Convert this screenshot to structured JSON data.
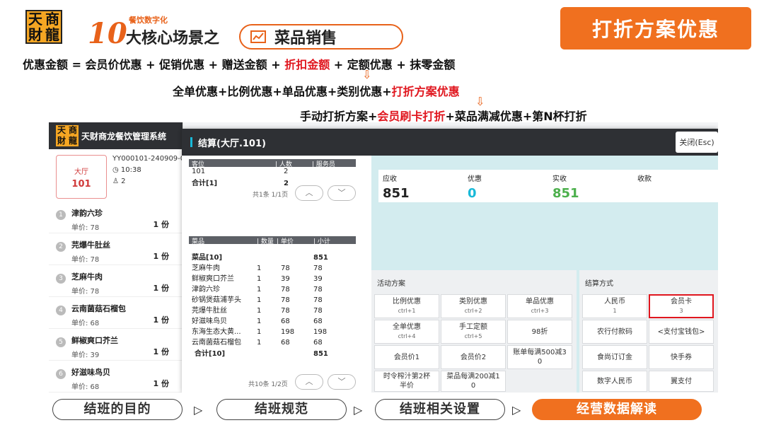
{
  "logo": {
    "chars": [
      "天",
      "商",
      "財",
      "龍"
    ]
  },
  "brand": {
    "ten": "10",
    "sub": "餐饮数字化",
    "main": "大核心场景之",
    "pill": "菜品销售"
  },
  "hero": "打折方案优惠",
  "formulas": {
    "line1_a": "优惠金额 = 会员价优惠 + 促销优惠 + 赠送金额 + ",
    "line1_hl": "折扣金额",
    "line1_b": " + 定额优惠 + 抹零金额",
    "line2_a": "全单优惠+比例优惠+单品优惠+类别优惠+",
    "line2_hl": "打折方案优惠",
    "line3_a": "手动打折方案+",
    "line3_hl": "会员刷卡打折",
    "line3_b": "+菜品满减优惠+第N杯打折",
    "arrow": "⇩"
  },
  "app": {
    "title": "天财商龙餐饮管理系统",
    "table_name": "大厅",
    "table_no": "101",
    "order_no": "YY000101-240909-0",
    "time": "10:38",
    "people": "2",
    "dishes": [
      {
        "n": "1",
        "name": "津韵六珍",
        "price": "单价:  78",
        "qty": "1 份"
      },
      {
        "n": "2",
        "name": "芫爆牛肚丝",
        "price": "单价:  78",
        "qty": "1 份"
      },
      {
        "n": "3",
        "name": "芝麻牛肉",
        "price": "单价:  78",
        "qty": "1 份"
      },
      {
        "n": "4",
        "name": "云南菌菇石榴包",
        "price": "单价:  68",
        "qty": "1 份"
      },
      {
        "n": "5",
        "name": "鲜椒爽口芥兰",
        "price": "单价:  39",
        "qty": "1 份"
      },
      {
        "n": "6",
        "name": "好滋味鸟贝",
        "price": "单价:  68",
        "qty": "1 份"
      }
    ]
  },
  "dialog": {
    "title": "结算(大厅.101)",
    "close": "关闭(Esc)",
    "seat_headers": [
      "客位",
      "| 人数",
      "| 服务员"
    ],
    "seat_rows": [
      {
        "a": "101",
        "b": "2"
      },
      {
        "a": "合计[1]",
        "b": "2"
      }
    ],
    "seat_pager": "共1条 1/1页",
    "dish_headers": [
      "菜品",
      "| 数量",
      "| 单价",
      "| 小计"
    ],
    "dish_group": {
      "name": "菜品[10]",
      "sub": "851"
    },
    "dish_rows": [
      {
        "name": "芝麻牛肉",
        "q": "1",
        "p": "78",
        "s": "78"
      },
      {
        "name": "鲜椒爽口芥兰",
        "q": "1",
        "p": "39",
        "s": "39"
      },
      {
        "name": "津韵六珍",
        "q": "1",
        "p": "78",
        "s": "78"
      },
      {
        "name": "砂锅煲菇浦芋头",
        "q": "1",
        "p": "78",
        "s": "78"
      },
      {
        "name": "芫爆牛肚丝",
        "q": "1",
        "p": "78",
        "s": "78"
      },
      {
        "name": "好滋味鸟贝",
        "q": "1",
        "p": "68",
        "s": "68"
      },
      {
        "name": "东海生态大黄...",
        "q": "1",
        "p": "198",
        "s": "198"
      },
      {
        "name": "云南菌菇石榴包",
        "q": "1",
        "p": "68",
        "s": "68"
      }
    ],
    "dish_total": {
      "name": "合计[10]",
      "s": "851"
    },
    "dish_pager": "共10条 1/2页",
    "up": "︿",
    "down": "﹀",
    "summary": [
      {
        "label": "应收",
        "value": "851",
        "color": "#222"
      },
      {
        "label": "优惠",
        "value": "0",
        "color": "#19b9d8"
      },
      {
        "label": "实收",
        "value": "851",
        "color": "#4cb04c"
      },
      {
        "label": "收款",
        "value": "",
        "color": "#222"
      }
    ],
    "act_title": "活动方案",
    "act_buttons": [
      {
        "t": "比例优惠",
        "s": "ctrl+1"
      },
      {
        "t": "类别优惠",
        "s": "ctrl+2"
      },
      {
        "t": "单品优惠",
        "s": "ctrl+3"
      },
      {
        "t": "全单优惠",
        "s": "ctrl+4"
      },
      {
        "t": "手工定额",
        "s": "ctrl+5"
      },
      {
        "t": "98折",
        "s": ""
      },
      {
        "t": "会员价1",
        "s": ""
      },
      {
        "t": "会员价2",
        "s": ""
      },
      {
        "t": "账单每满500减3",
        "s": "0"
      },
      {
        "t": "时令榨汁第2杯",
        "s": "半价"
      },
      {
        "t": "菜品每满200减1",
        "s": "0"
      }
    ],
    "pay_title": "结算方式",
    "pay_buttons": [
      {
        "t": "人民币",
        "s": "1"
      },
      {
        "t": "会员卡",
        "s": "3"
      },
      {
        "t": "农行付款码",
        "s": ""
      },
      {
        "t": "<支付宝钱包>",
        "s": ""
      },
      {
        "t": "食尚订订金",
        "s": ""
      },
      {
        "t": "快手券",
        "s": ""
      },
      {
        "t": "数字人民币",
        "s": ""
      },
      {
        "t": "翼支付",
        "s": ""
      }
    ]
  },
  "steps": [
    "结班的目的",
    "结班规范",
    "结班相关设置",
    "经营数据解读"
  ],
  "step_arrow": "▷"
}
